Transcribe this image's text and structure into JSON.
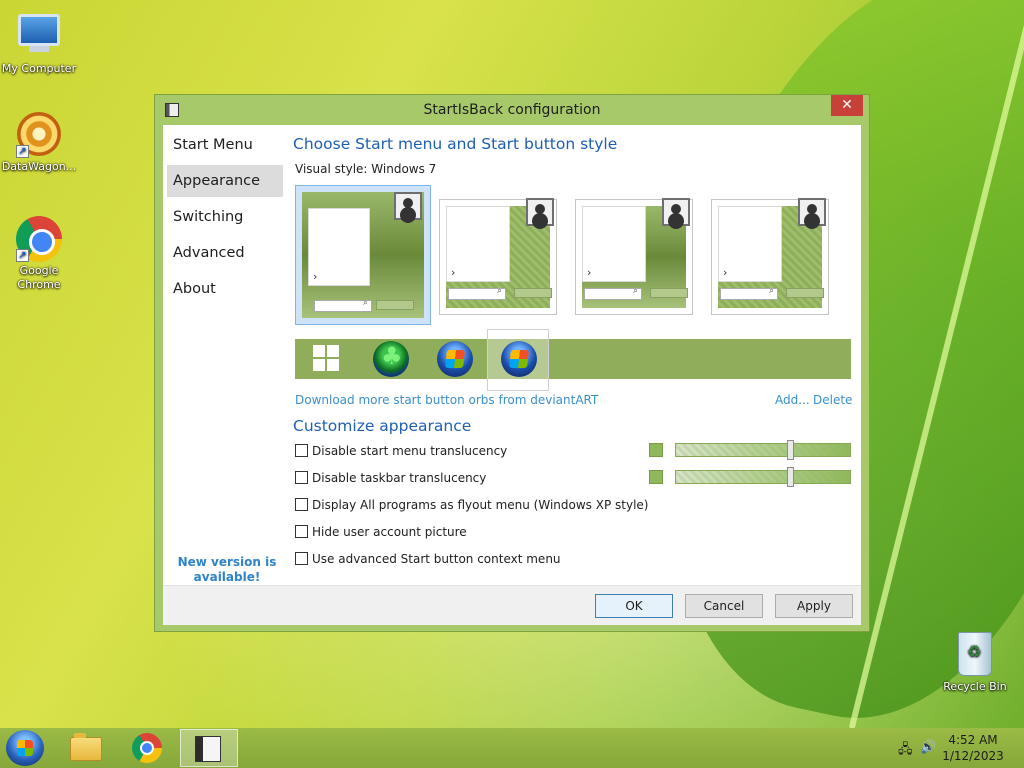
{
  "desktop": {
    "icons": [
      {
        "label": "My Computer"
      },
      {
        "label": "DataWagon..."
      },
      {
        "label": "Google Chrome"
      },
      {
        "label": "Recycle Bin"
      }
    ]
  },
  "dialog": {
    "title": "StartIsBack configuration",
    "close_glyph": "✕",
    "nav": [
      {
        "label": "Start Menu",
        "active": false
      },
      {
        "label": "Appearance",
        "active": true
      },
      {
        "label": "Switching",
        "active": false
      },
      {
        "label": "Advanced",
        "active": false
      },
      {
        "label": "About",
        "active": false
      }
    ],
    "new_version": "New version is available!",
    "section_style": "Choose Start menu and Start button style",
    "visual_style_label": "Visual style:",
    "visual_style_value": "Windows 7",
    "styles": [
      {
        "pattern": "gradient",
        "selected": true
      },
      {
        "pattern": "checker",
        "selected": false
      },
      {
        "pattern": "gradient",
        "selected": false
      },
      {
        "pattern": "checker",
        "selected": false
      }
    ],
    "orbs": [
      {
        "icon": "windows8-logo-icon",
        "selected": false
      },
      {
        "icon": "clover-orb-icon",
        "selected": false
      },
      {
        "icon": "windows7-orb-icon",
        "selected": false
      },
      {
        "icon": "windows7-orb-icon",
        "selected": true
      }
    ],
    "download_link": "Download more start button orbs from deviantART",
    "add_link": "Add...",
    "delete_link": "Delete",
    "section_customize": "Customize appearance",
    "options": [
      {
        "label": "Disable start menu translucency",
        "checked": false,
        "slider_value": 0.66
      },
      {
        "label": "Disable taskbar translucency",
        "checked": false,
        "slider_value": 0.66
      },
      {
        "label": "Display All programs as flyout menu (Windows XP style)",
        "checked": false
      },
      {
        "label": "Hide user account picture",
        "checked": false
      },
      {
        "label": "Use advanced Start button context menu",
        "checked": false
      }
    ],
    "buttons": {
      "ok": "OK",
      "cancel": "Cancel",
      "apply": "Apply"
    },
    "accent_color": "#1f5fb2",
    "link_color": "#3a8fd0"
  },
  "taskbar": {
    "items": [
      {
        "icon": "file-explorer-icon"
      },
      {
        "icon": "chrome-icon"
      },
      {
        "icon": "startisback-icon",
        "active": true
      }
    ],
    "tray": {
      "network_glyph": "🖧",
      "volume_glyph": "🔊"
    },
    "clock": {
      "time": "4:52 AM",
      "date": "1/12/2023"
    }
  }
}
